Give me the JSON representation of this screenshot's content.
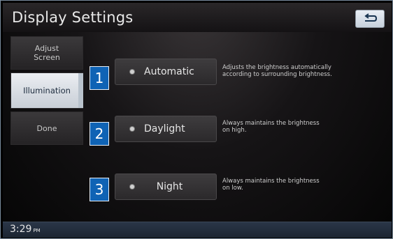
{
  "header": {
    "title": "Display Settings",
    "back_icon": "return-arrow-icon"
  },
  "sidebar": {
    "items": [
      {
        "label": "Adjust\nScreen",
        "active": false
      },
      {
        "label": "Illumination",
        "active": true
      },
      {
        "label": "Done",
        "active": false
      }
    ]
  },
  "options": [
    {
      "number": "1",
      "label": "Automatic",
      "description": "Adjusts the brightness automatically\naccording to surrounding brightness."
    },
    {
      "number": "2",
      "label": "Daylight",
      "description": "Always maintains the brightness\non high."
    },
    {
      "number": "3",
      "label": "Night",
      "description": "Always maintains the brightness\non low."
    }
  ],
  "status": {
    "time": "3:29",
    "ampm": "PM"
  },
  "colors": {
    "badge": "#0f63b5",
    "active_tab": "#d9dee4",
    "statusbar": "#1e2836"
  }
}
